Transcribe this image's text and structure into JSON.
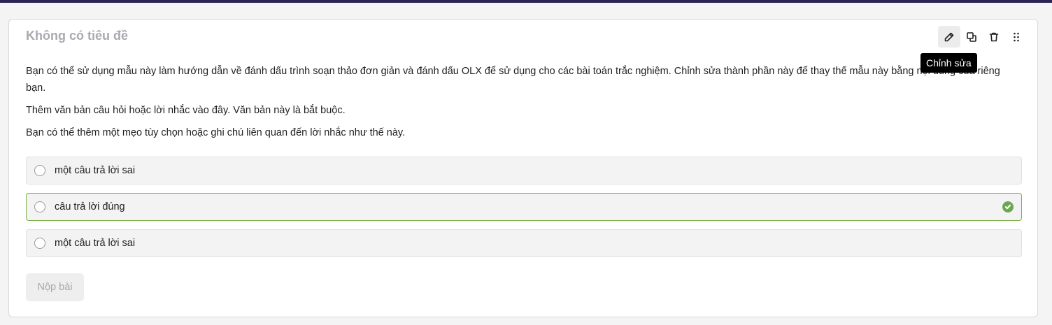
{
  "block": {
    "title": "Không có tiêu đề",
    "toolbar": {
      "edit_icon": "pencil-icon",
      "duplicate_icon": "copy-icon",
      "delete_icon": "trash-icon",
      "drag_icon": "drag-handle-icon",
      "tooltip": "Chỉnh sửa"
    },
    "paragraphs": [
      "Bạn có thể sử dụng mẫu này làm hướng dẫn về đánh dấu trình soạn thảo đơn giản và đánh dấu OLX để sử dụng cho các bài toán trắc nghiệm. Chỉnh sửa thành phần này để thay thế mẫu này bằng nội dung của riêng bạn.",
      "Thêm văn bản câu hỏi hoặc lời nhắc vào đây. Văn bản này là bắt buộc.",
      "Bạn có thể thêm một mẹo tùy chọn hoặc ghi chú liên quan đến lời nhắc như thế này."
    ],
    "options": [
      {
        "label": "một câu trả lời sai",
        "correct": false
      },
      {
        "label": "câu trả lời đúng",
        "correct": true
      },
      {
        "label": "một câu trả lời sai",
        "correct": false
      }
    ],
    "submit_label": "Nộp bài"
  },
  "colors": {
    "topbar": "#2b2554",
    "correct_border": "#7db149",
    "check": "#6aa84f"
  }
}
